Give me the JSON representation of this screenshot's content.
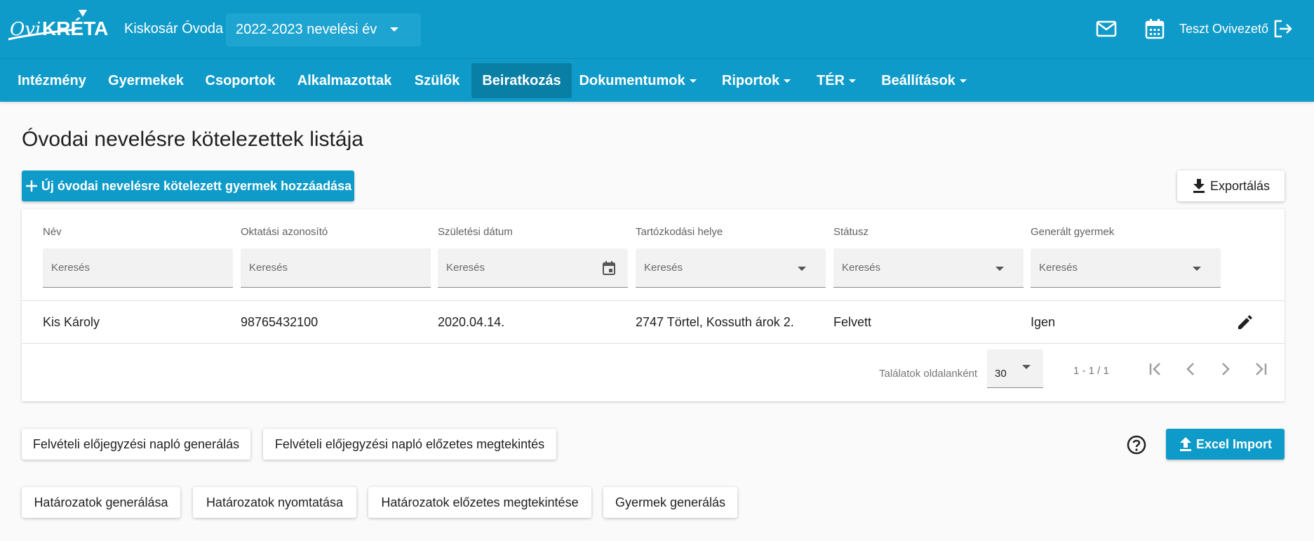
{
  "app": {
    "logo_text": "OviKRÉTA",
    "org_name": "Kiskosár Óvoda",
    "year_select": "2022-2023 nevelési év",
    "user_name": "Teszt Ovivezető"
  },
  "nav": {
    "items": [
      {
        "label": "Intézmény"
      },
      {
        "label": "Gyermekek"
      },
      {
        "label": "Csoportok"
      },
      {
        "label": "Alkalmazottak"
      },
      {
        "label": "Szülők"
      },
      {
        "label": "Beiratkozás"
      },
      {
        "label": "Dokumentumok"
      },
      {
        "label": "Riportok"
      },
      {
        "label": "TÉR"
      },
      {
        "label": "Beállítások"
      }
    ]
  },
  "page": {
    "title": "Óvodai nevelésre kötelezettek listája",
    "add_button": "Új óvodai nevelésre kötelezett gyermek hozzáadása",
    "export_button": "Exportálás"
  },
  "table": {
    "columns": [
      {
        "header": "Név",
        "placeholder": "Keresés"
      },
      {
        "header": "Oktatási azonosító",
        "placeholder": "Keresés"
      },
      {
        "header": "Születési dátum",
        "placeholder": "Keresés"
      },
      {
        "header": "Tartózkodási helye",
        "placeholder": "Keresés"
      },
      {
        "header": "Státusz",
        "placeholder": "Keresés"
      },
      {
        "header": "Generált gyermek",
        "placeholder": "Keresés"
      }
    ],
    "rows": [
      [
        "Kis Károly",
        "98765432100",
        "2020.04.14.",
        "2747 Törtel, Kossuth árok 2.",
        "Felvett",
        "Igen"
      ]
    ],
    "pager": {
      "per_page_label": "Találatok oldalanként",
      "per_page_value": "30",
      "range": "1 - 1 / 1"
    }
  },
  "actions": {
    "row1": [
      "Felvételi előjegyzési napló generálás",
      "Felvételi előjegyzési napló előzetes megtekintés"
    ],
    "excel_import": "Excel Import",
    "row2": [
      "Határozatok generálása",
      "Határozatok nyomtatása",
      "Határozatok előzetes megtekintése",
      "Gyermek generálás"
    ]
  },
  "colors": {
    "primary": "#0f9bc9",
    "nav_active": "#0a7fa6"
  }
}
